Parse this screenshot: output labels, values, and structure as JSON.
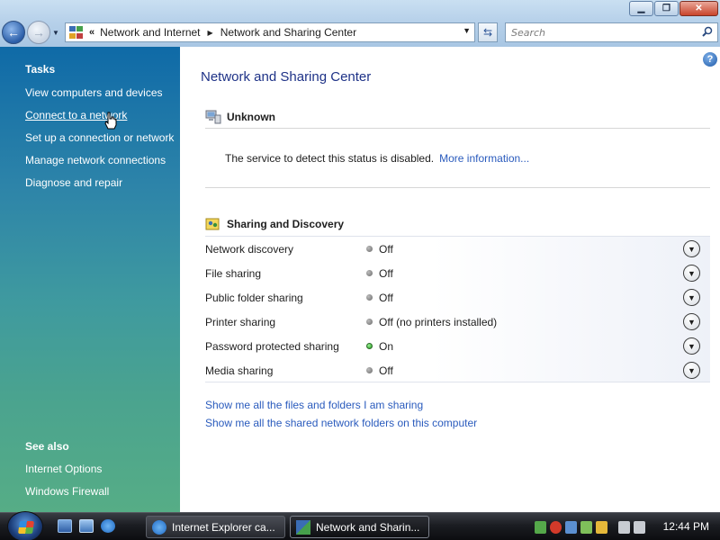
{
  "window": {
    "controls": [
      "minimize",
      "maximize",
      "close"
    ]
  },
  "address_bar": {
    "prefix": "«",
    "crumbs": [
      "Network and Internet",
      "Network and Sharing Center"
    ]
  },
  "search": {
    "placeholder": "Search"
  },
  "sidebar": {
    "tasks_heading": "Tasks",
    "tasks": [
      "View computers and devices",
      "Connect to a network",
      "Set up a connection or network",
      "Manage network connections",
      "Diagnose and repair"
    ],
    "see_also_heading": "See also",
    "see_also": [
      "Internet Options",
      "Windows Firewall"
    ]
  },
  "main": {
    "help_glyph": "?",
    "title": "Network and Sharing Center",
    "network": {
      "name": "Unknown",
      "status_text": "The service to detect this status is disabled.",
      "more_info_link": "More information..."
    },
    "sharing": {
      "heading": "Sharing and Discovery",
      "rows": [
        {
          "label": "Network discovery",
          "value": "Off",
          "on": false
        },
        {
          "label": "File sharing",
          "value": "Off",
          "on": false
        },
        {
          "label": "Public folder sharing",
          "value": "Off",
          "on": false
        },
        {
          "label": "Printer sharing",
          "value": "Off (no printers installed)",
          "on": false
        },
        {
          "label": "Password protected sharing",
          "value": "On",
          "on": true
        },
        {
          "label": "Media sharing",
          "value": "Off",
          "on": false
        }
      ]
    },
    "links": [
      "Show me all the files and folders I am sharing",
      "Show me all the shared network folders on this computer"
    ]
  },
  "taskbar": {
    "buttons": [
      {
        "label": "Internet Explorer ca...",
        "active": false
      },
      {
        "label": "Network and Sharin...",
        "active": true
      }
    ],
    "clock": "12:44 PM"
  },
  "colors": {
    "link": "#2a5bbd",
    "title": "#1e3287",
    "status_on": "#1f9a1a",
    "status_off": "#6a6a6a"
  }
}
